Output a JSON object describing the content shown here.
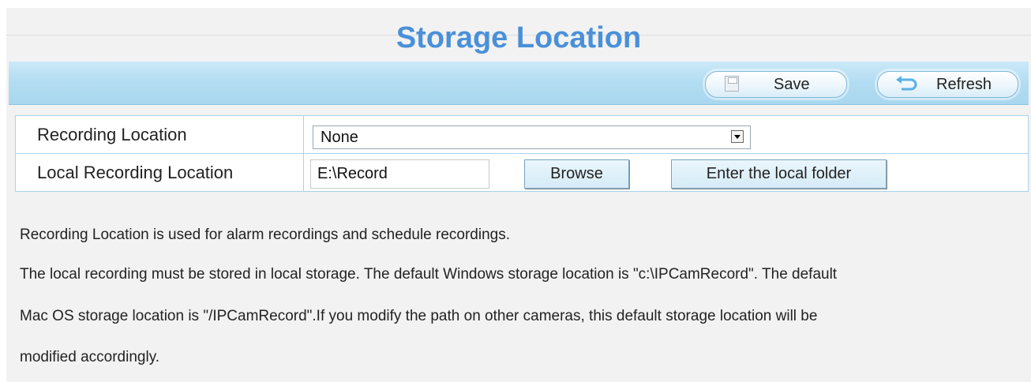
{
  "page": {
    "title": "Storage Location"
  },
  "toolbar": {
    "save_label": "Save",
    "refresh_label": "Refresh"
  },
  "form": {
    "recording_location": {
      "label": "Recording Location",
      "selected": "None"
    },
    "local_recording_location": {
      "label": "Local Recording Location",
      "value": "E:\\Record",
      "browse_label": "Browse",
      "enter_folder_label": "Enter the local folder"
    }
  },
  "description": {
    "line1": "Recording Location is used for alarm recordings and schedule recordings.",
    "line2": "The local recording must be stored in local storage. The default Windows storage location is \"c:\\IPCamRecord\". The default",
    "line3": "Mac OS storage location is \"/IPCamRecord\".If you modify the path on other cameras, this default storage location will be",
    "line4": "modified accordingly."
  },
  "colors": {
    "title": "#4a90d9",
    "toolbar": "#b2dcf1",
    "border": "#a7d3ec"
  }
}
